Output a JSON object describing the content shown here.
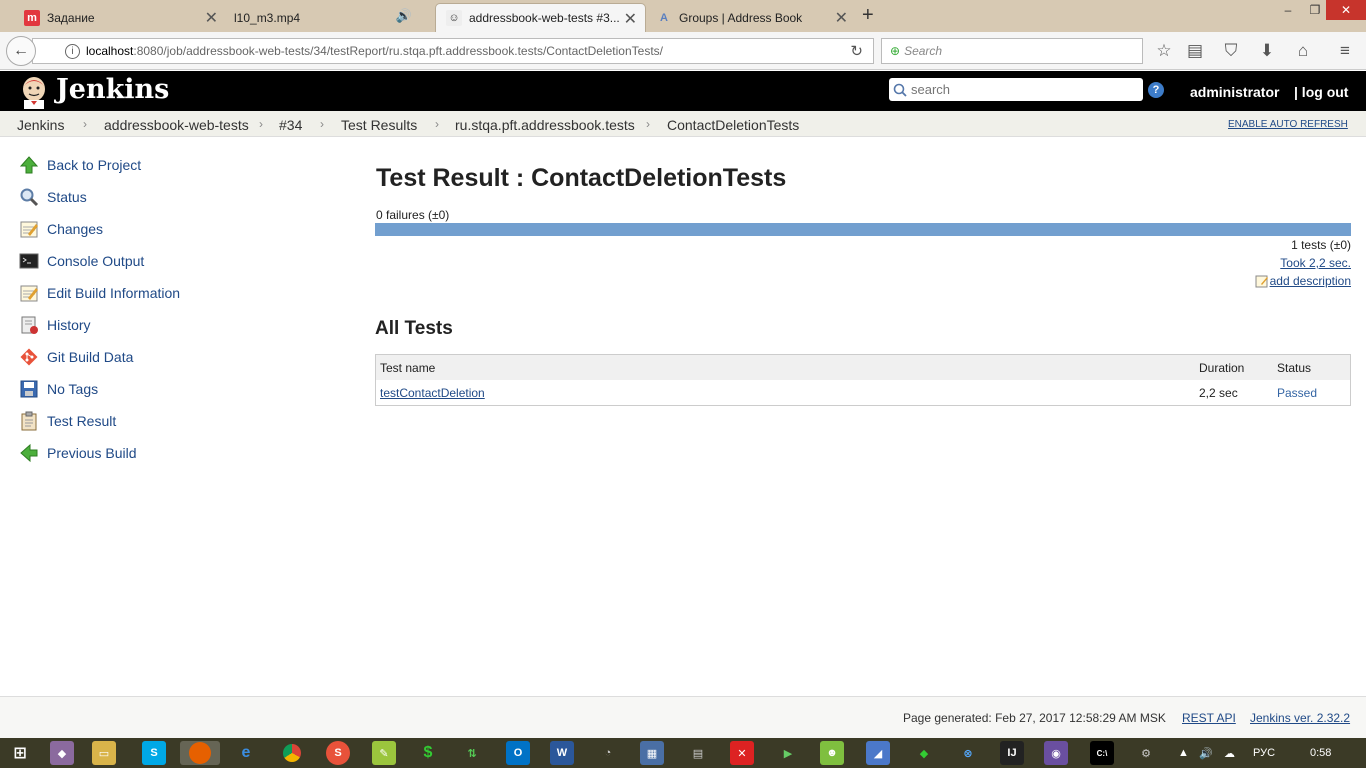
{
  "browser": {
    "tabs": [
      {
        "label": "Задание",
        "icon": "m",
        "color": "#e2373f",
        "active": false
      },
      {
        "label": "l10_m3.mp4",
        "active": false
      },
      {
        "label": "addressbook-web-tests #3...",
        "active": true
      },
      {
        "label": "Groups | Address Book",
        "active": false
      }
    ],
    "url_host": "localhost",
    "url_path": ":8080/job/addressbook-web-tests/34/testReport/ru.stqa.pft.addressbook.tests/ContactDeletionTests/",
    "search_placeholder": "Search"
  },
  "jenkins": {
    "brand": "Jenkins",
    "search_placeholder": "search",
    "help": "?",
    "user": "administrator",
    "logout": "| log out"
  },
  "breadcrumbs": [
    "Jenkins",
    "addressbook-web-tests",
    "#34",
    "Test Results",
    "ru.stqa.pft.addressbook.tests",
    "ContactDeletionTests"
  ],
  "auto_refresh": "ENABLE AUTO REFRESH",
  "sidebar": [
    {
      "label": "Back to Project",
      "icon": "up-arrow-icon"
    },
    {
      "label": "Status",
      "icon": "magnifier-icon"
    },
    {
      "label": "Changes",
      "icon": "notepad-icon"
    },
    {
      "label": "Console Output",
      "icon": "terminal-icon"
    },
    {
      "label": "Edit Build Information",
      "icon": "notepad-icon"
    },
    {
      "label": "History",
      "icon": "history-icon"
    },
    {
      "label": "Git Build Data",
      "icon": "git-icon"
    },
    {
      "label": "No Tags",
      "icon": "save-icon"
    },
    {
      "label": "Test Result",
      "icon": "clipboard-icon"
    },
    {
      "label": "Previous Build",
      "icon": "left-arrow-icon"
    }
  ],
  "main": {
    "title": "Test Result : ContactDeletionTests",
    "failures": "0 failures (±0)",
    "pass_fraction": 1.0,
    "tests_count": "1 tests (±0)",
    "took": "Took 2,2 sec.",
    "add_description": "add description",
    "all_tests_heading": "All Tests",
    "table": {
      "headers": [
        "Test name",
        "Duration",
        "Status"
      ],
      "rows": [
        {
          "name": "testContactDeletion",
          "duration": "2,2 sec",
          "status": "Passed"
        }
      ]
    }
  },
  "footer": {
    "generated": "Page generated: Feb 27, 2017 12:58:29 AM MSK",
    "rest_api": "REST API",
    "version": "Jenkins ver. 2.32.2"
  },
  "taskbar": {
    "lang": "РУС",
    "time": "0:58"
  },
  "colors": {
    "link": "#204a87",
    "bar": "#729fcf",
    "header_bg": "#000000"
  }
}
